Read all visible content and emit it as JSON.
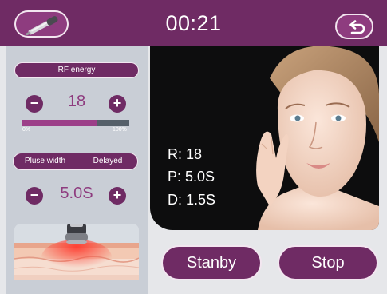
{
  "header": {
    "timer": "00:21",
    "handpiece_icon": "rf-handpiece-icon",
    "back_icon": "return-arrow-icon"
  },
  "rf_energy": {
    "label": "RF energy",
    "value": "18",
    "minus_label": "−",
    "plus_label": "+",
    "level_fraction": 0.7,
    "scale_min": "0%",
    "scale_max": "100%"
  },
  "timing": {
    "tabs": [
      "Pluse width",
      "Delayed"
    ],
    "selected_tab": "Pluse width",
    "value": "5.0S",
    "minus_label": "−",
    "plus_label": "+"
  },
  "readout": {
    "r": "R: 18",
    "p": "P: 5.0S",
    "d": "D: 1.5S"
  },
  "actions": {
    "standby_label": "Stanby",
    "stop_label": "Stop"
  },
  "colors": {
    "primary": "#6f2b64",
    "accent": "#9c3f89",
    "panel": "#c9ced6",
    "background": "#e6e7ea"
  }
}
